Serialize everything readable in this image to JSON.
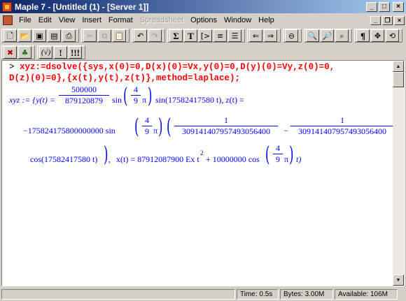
{
  "window": {
    "title": "Maple 7 - [Untitled (1) - [Server 1]]"
  },
  "menu": [
    {
      "label": "File",
      "enabled": true
    },
    {
      "label": "Edit",
      "enabled": true
    },
    {
      "label": "View",
      "enabled": true
    },
    {
      "label": "Insert",
      "enabled": true
    },
    {
      "label": "Format",
      "enabled": true
    },
    {
      "label": "Spreadsheet",
      "enabled": false
    },
    {
      "label": "Options",
      "enabled": true
    },
    {
      "label": "Window",
      "enabled": true
    },
    {
      "label": "Help",
      "enabled": true
    }
  ],
  "toolbar2": {
    "exec_glyph": "(√)",
    "bang_glyph": "!",
    "bang3_glyph": "!!!"
  },
  "worksheet": {
    "prompt": ">",
    "input_line1": "xyz:=dsolve({sys,x(0)=0,D(x)(0)=Vx,y(0)=0,D(y)(0)=Vy,z(0)=0,",
    "input_line2": "D(z)(0)=0},{x(t),y(t),z(t)},method=laplace);",
    "output": {
      "lhs": "xyz := {y(t) =",
      "frac1_num": "500000",
      "frac1_den": "879120879",
      "sin": "sin",
      "four": "4",
      "nine": "9",
      "pi": "π",
      "sin_arg": "sin(17582417580 t), z(t) =",
      "neg_coef": "−175824175800000000 sin",
      "frac2_num": "1",
      "frac2_den": "309141407957493056400",
      "minus": "−",
      "frac3_num": "1",
      "frac3_den": "309141407957493056400",
      "cos_line": "cos(17582417580 t)",
      "x_eq": "x(t) = 87912087900 Ex t",
      "sq": "2",
      "x_tail": "+ 10000000 cos",
      "t_close": "t)"
    }
  },
  "status": {
    "time": "Time:  0.5s",
    "bytes": "Bytes: 3.00M",
    "available": "Available: 106M"
  }
}
